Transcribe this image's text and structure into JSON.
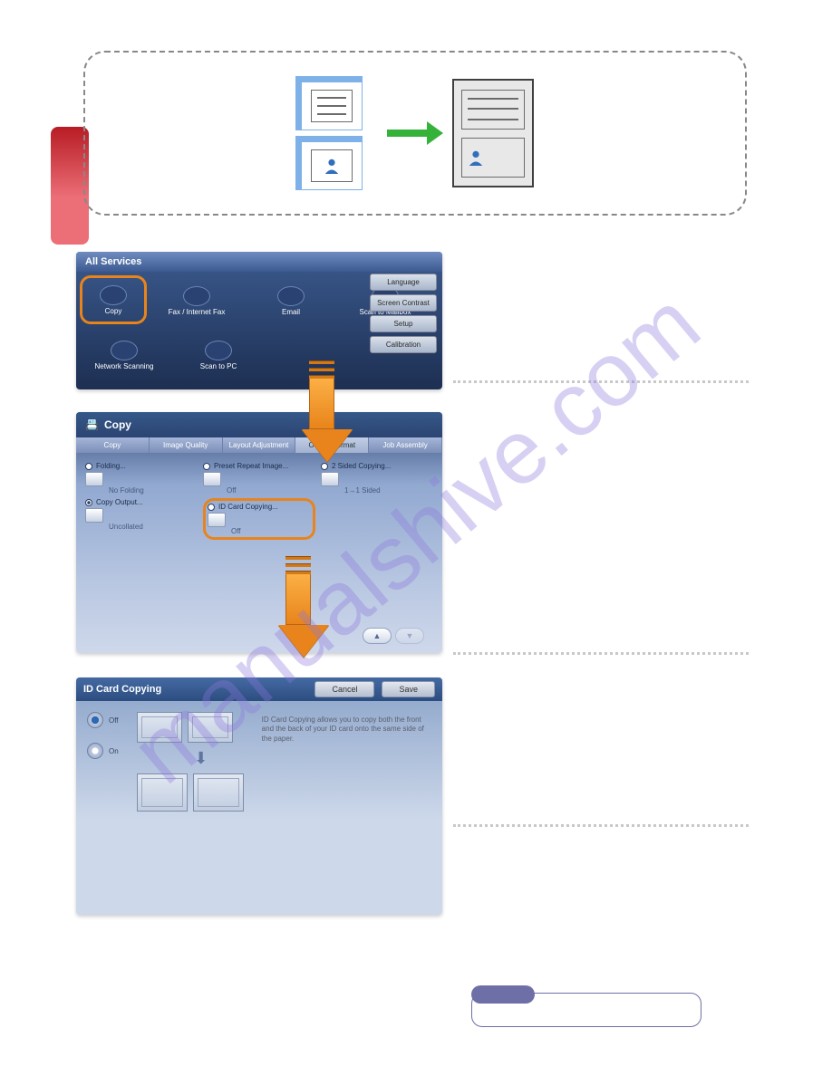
{
  "watermark": "manualshive.com",
  "screen1": {
    "title": "All Services",
    "services": [
      {
        "label": "Copy"
      },
      {
        "label": "Fax / Internet Fax"
      },
      {
        "label": "Email"
      },
      {
        "label": "Scan to Mailbox"
      },
      {
        "label": "Network Scanning"
      },
      {
        "label": "Scan to PC"
      }
    ],
    "side_buttons": [
      "Language",
      "Screen Contrast",
      "Setup",
      "Calibration"
    ]
  },
  "screen2": {
    "header": "Copy",
    "tabs": [
      "Copy",
      "Image Quality",
      "Layout Adjustment",
      "Output Format",
      "Job Assembly"
    ],
    "options": {
      "folding": {
        "label": "Folding...",
        "value": "No Folding"
      },
      "preset": {
        "label": "Preset Repeat Image...",
        "value": "Off"
      },
      "twosided": {
        "label": "2 Sided Copying...",
        "value": "1→1 Sided"
      },
      "copy_output": {
        "label": "Copy Output...",
        "value": "Uncollated"
      },
      "id_card": {
        "label": "ID Card Copying...",
        "value": "Off"
      }
    }
  },
  "screen3": {
    "title": "ID Card Copying",
    "buttons": {
      "cancel": "Cancel",
      "save": "Save"
    },
    "radio_off": "Off",
    "radio_on": "On",
    "help": "ID Card Copying allows you to copy both the front and the back of your ID card onto the same side of the paper."
  }
}
